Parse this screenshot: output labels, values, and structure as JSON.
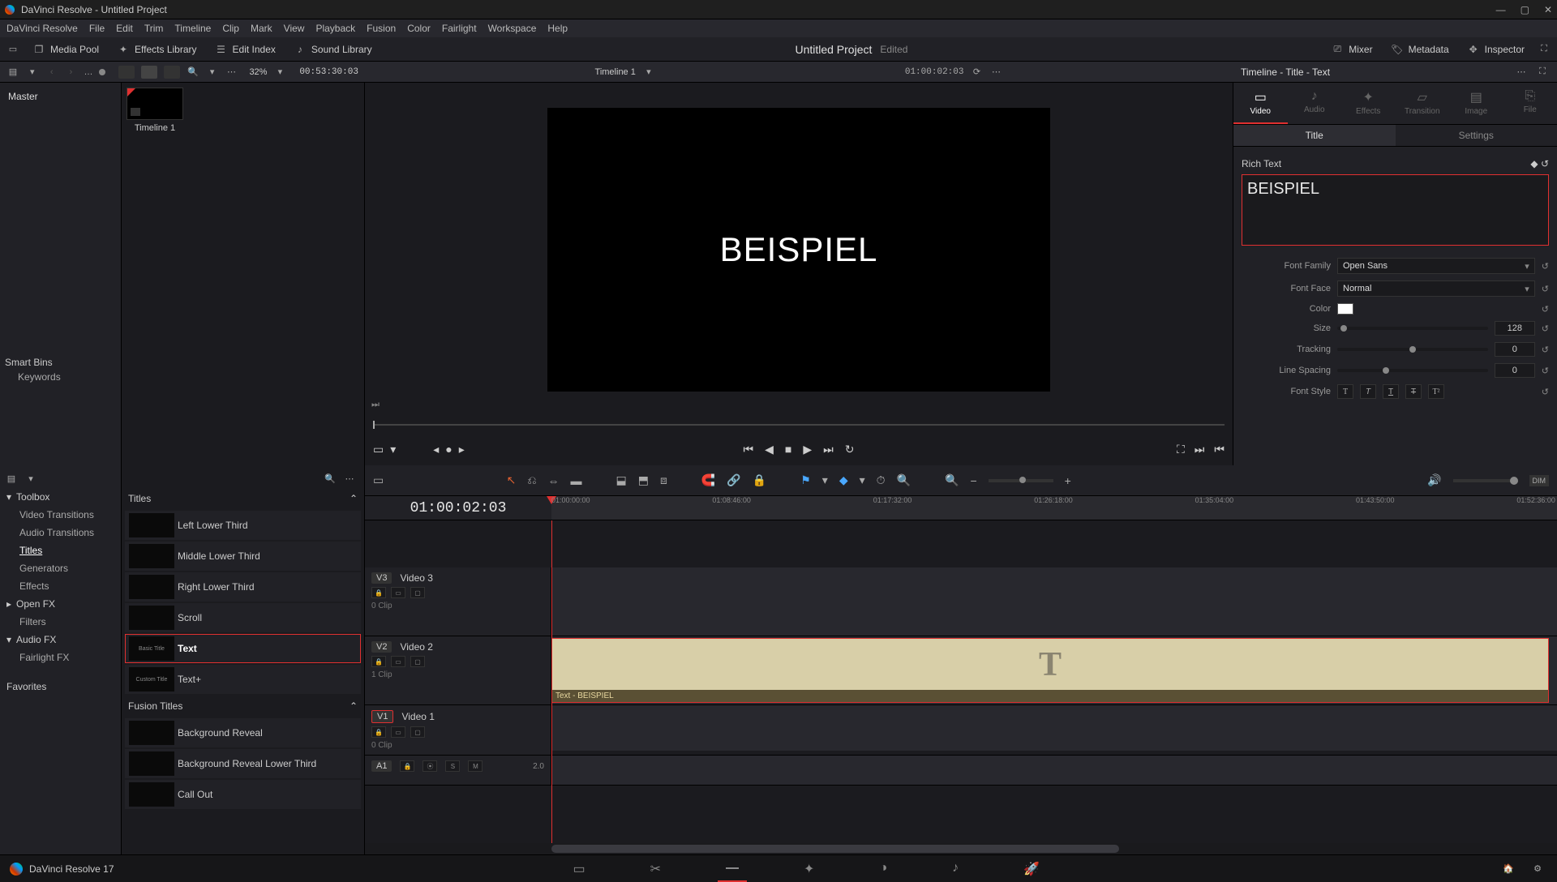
{
  "window": {
    "title": "DaVinci Resolve - Untitled Project"
  },
  "menubar": [
    "DaVinci Resolve",
    "File",
    "Edit",
    "Trim",
    "Timeline",
    "Clip",
    "Mark",
    "View",
    "Playback",
    "Fusion",
    "Color",
    "Fairlight",
    "Workspace",
    "Help"
  ],
  "toolbar2": {
    "mediapool": "Media Pool",
    "effects": "Effects Library",
    "editindex": "Edit Index",
    "soundlib": "Sound Library",
    "project": "Untitled Project",
    "edited": "Edited",
    "mixer": "Mixer",
    "metadata": "Metadata",
    "inspector": "Inspector"
  },
  "subbar": {
    "zoom": "32%",
    "source_tc": "00:53:30:03",
    "timeline_name": "Timeline 1",
    "rec_tc": "01:00:02:03",
    "breadcrumb": "Timeline - Title - Text"
  },
  "mediapool": {
    "bin": "Master",
    "smart": "Smart Bins",
    "keywords": "Keywords"
  },
  "clip": {
    "name": "Timeline 1"
  },
  "viewer": {
    "text": "BEISPIEL"
  },
  "inspector": {
    "tabs": [
      "Video",
      "Audio",
      "Effects",
      "Transition",
      "Image",
      "File"
    ],
    "subtabs": [
      "Title",
      "Settings"
    ],
    "section": "Rich Text",
    "richtext": "BEISPIEL",
    "rows": {
      "fontfamily": {
        "label": "Font Family",
        "value": "Open Sans"
      },
      "fontface": {
        "label": "Font Face",
        "value": "Normal"
      },
      "color": {
        "label": "Color"
      },
      "size": {
        "label": "Size",
        "value": "128"
      },
      "tracking": {
        "label": "Tracking",
        "value": "0"
      },
      "linespacing": {
        "label": "Line Spacing",
        "value": "0"
      },
      "fontstyle": {
        "label": "Font Style"
      }
    }
  },
  "fxbrowser": {
    "toolbox": "Toolbox",
    "items": [
      "Video Transitions",
      "Audio Transitions",
      "Titles",
      "Generators",
      "Effects"
    ],
    "openfx": "Open FX",
    "filters": "Filters",
    "audiofx": "Audio FX",
    "fairlightfx": "Fairlight FX",
    "favorites": "Favorites"
  },
  "titlelist": {
    "group1": "Titles",
    "items1": [
      {
        "thumb": "",
        "name": "Left Lower Third"
      },
      {
        "thumb": "",
        "name": "Middle Lower Third"
      },
      {
        "thumb": "",
        "name": "Right Lower Third"
      },
      {
        "thumb": "",
        "name": "Scroll"
      },
      {
        "thumb": "Basic Title",
        "name": "Text",
        "selected": true
      },
      {
        "thumb": "Custom Title",
        "name": "Text+"
      }
    ],
    "group2": "Fusion Titles",
    "items2": [
      {
        "name": "Background Reveal"
      },
      {
        "name": "Background Reveal Lower Third"
      },
      {
        "name": "Call Out"
      }
    ]
  },
  "timeline": {
    "tc": "01:00:02:03",
    "ticks": [
      "01:00:00:00",
      "01:08:46:00",
      "01:17:32:00",
      "01:26:18:00",
      "01:35:04:00",
      "01:43:50:00",
      "01:52:36:00"
    ],
    "tracks": {
      "v3": {
        "badge": "V3",
        "name": "Video 3",
        "count": "0 Clip"
      },
      "v2": {
        "badge": "V2",
        "name": "Video 2",
        "count": "1 Clip",
        "clip": "Text - BEISPIEL"
      },
      "v1": {
        "badge": "V1",
        "name": "Video 1",
        "count": "0 Clip"
      },
      "a1": {
        "badge": "A1",
        "meter": "2.0"
      }
    },
    "dim": "DIM"
  },
  "bottombar": {
    "app": "DaVinci Resolve 17"
  }
}
